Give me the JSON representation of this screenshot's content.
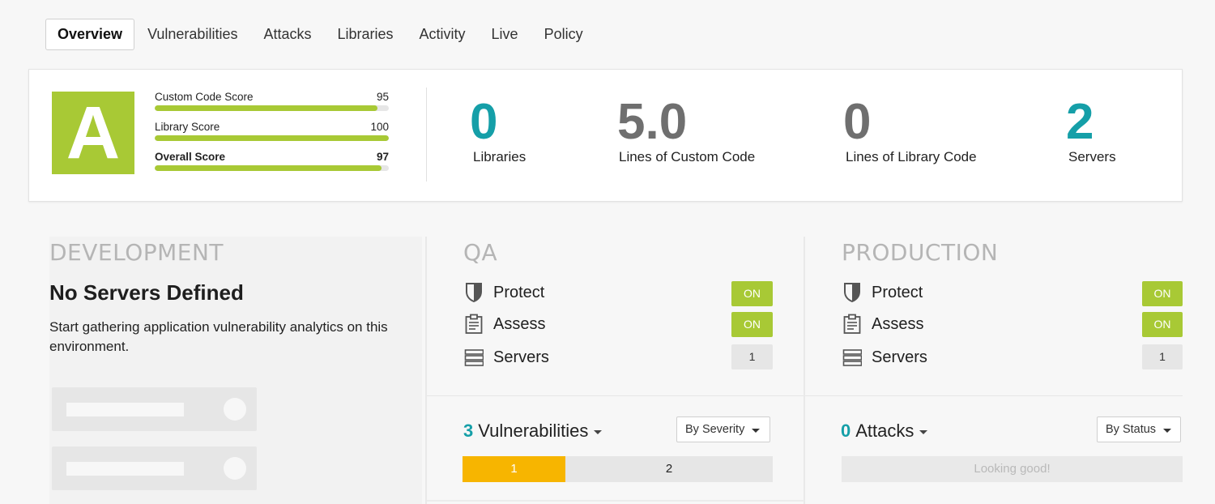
{
  "tabs": [
    "Overview",
    "Vulnerabilities",
    "Attacks",
    "Libraries",
    "Activity",
    "Live",
    "Policy"
  ],
  "summary": {
    "grade": "A",
    "scores": [
      {
        "label": "Custom Code Score",
        "value": "95",
        "fill": 0.95
      },
      {
        "label": "Library Score",
        "value": "100",
        "fill": 1.0
      },
      {
        "label": "Overall Score",
        "value": "97",
        "fill": 0.97
      }
    ],
    "stats": [
      {
        "value": "0",
        "label": "Libraries",
        "color": "#159fa8"
      },
      {
        "value": "5.0",
        "label": "Lines of Custom Code",
        "color": "#6f6f6f"
      },
      {
        "value": "0",
        "label": "Lines of Library Code",
        "color": "#6f6f6f"
      },
      {
        "value": "2",
        "label": "Servers",
        "color": "#159fa8"
      }
    ]
  },
  "development": {
    "title": "DEVELOPMENT",
    "heading": "No Servers Defined",
    "text": "Start gathering application vulnerability analytics on this environment."
  },
  "qa": {
    "title": "QA",
    "protect_label": "Protect",
    "protect_state": "ON",
    "assess_label": "Assess",
    "assess_state": "ON",
    "servers_label": "Servers",
    "servers_count": "1",
    "metric_count": "3",
    "metric_label": "Vulnerabilities",
    "sort_label": "By Severity",
    "severity": [
      {
        "count": "1",
        "color": "#f7b500"
      },
      {
        "count": "2",
        "color": "#e6e6e6"
      }
    ]
  },
  "production": {
    "title": "PRODUCTION",
    "protect_label": "Protect",
    "protect_state": "ON",
    "assess_label": "Assess",
    "assess_state": "ON",
    "servers_label": "Servers",
    "servers_count": "1",
    "metric_count": "0",
    "metric_label": "Attacks",
    "sort_label": "By Status",
    "empty_text": "Looking good!"
  },
  "icons": [
    "shield-icon",
    "clipboard-icon",
    "server-stack-icon",
    "caret-down-icon"
  ],
  "colors": {
    "accent_green": "#a8c935",
    "teal": "#159fa8",
    "high_severity": "#f7b500"
  }
}
